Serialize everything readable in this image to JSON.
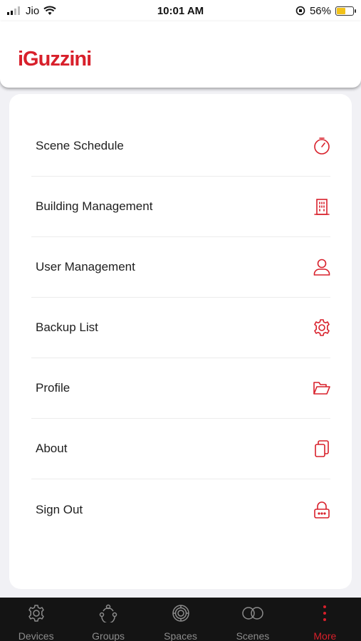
{
  "status_bar": {
    "carrier": "Jio",
    "time": "10:01 AM",
    "battery": "56%",
    "battery_level": 0.56
  },
  "header": {
    "logo": "iGuzzini",
    "brand_color": "#d8202b"
  },
  "menu": {
    "items": [
      {
        "label": "Scene Schedule",
        "icon": "timer-icon"
      },
      {
        "label": "Building Management",
        "icon": "building-icon"
      },
      {
        "label": "User Management",
        "icon": "user-icon"
      },
      {
        "label": "Backup List",
        "icon": "gear-icon"
      },
      {
        "label": "Profile",
        "icon": "folder-open-icon"
      },
      {
        "label": "About",
        "icon": "copy-icon"
      },
      {
        "label": "Sign Out",
        "icon": "lock-icon"
      }
    ]
  },
  "tab_bar": {
    "tabs": [
      {
        "label": "Devices",
        "icon": "gear-icon"
      },
      {
        "label": "Groups",
        "icon": "groups-icon"
      },
      {
        "label": "Spaces",
        "icon": "spaces-icon"
      },
      {
        "label": "Scenes",
        "icon": "scenes-icon"
      },
      {
        "label": "More",
        "icon": "more-vertical-icon",
        "active": true
      }
    ]
  }
}
